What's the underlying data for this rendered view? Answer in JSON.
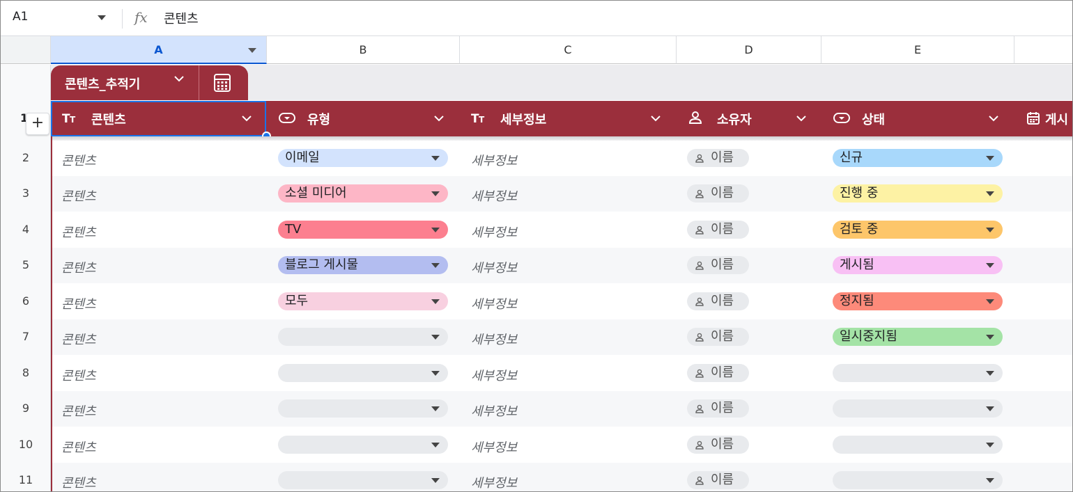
{
  "formula_bar": {
    "cell_ref": "A1",
    "fx": "fx",
    "content": "콘텐츠"
  },
  "columns": [
    "A",
    "B",
    "C",
    "D",
    "E"
  ],
  "table": {
    "name": "콘텐츠_추적기"
  },
  "headers": [
    {
      "label": "콘텐츠",
      "icon": "text-type-icon"
    },
    {
      "label": "유형",
      "icon": "dropdown-chip-icon"
    },
    {
      "label": "세부정보",
      "icon": "text-type-icon"
    },
    {
      "label": "소유자",
      "icon": "person-icon"
    },
    {
      "label": "상태",
      "icon": "dropdown-chip-icon"
    },
    {
      "label": "게시",
      "icon": "calendar-icon"
    }
  ],
  "header_row_number": "1",
  "rows": [
    {
      "num": "2",
      "content": "콘텐츠",
      "type": "이메일",
      "type_color": "#d3e3fd",
      "details": "세부정보",
      "owner": "이름",
      "status": "신규",
      "status_color": "#a8d8fb"
    },
    {
      "num": "3",
      "content": "콘텐츠",
      "type": "소셜 미디어",
      "type_color": "#fdb6c6",
      "details": "세부정보",
      "owner": "이름",
      "status": "진행 중",
      "status_color": "#fdf2a4"
    },
    {
      "num": "4",
      "content": "콘텐츠",
      "type": "TV",
      "type_color": "#fc7f8f",
      "details": "세부정보",
      "owner": "이름",
      "status": "검토 중",
      "status_color": "#fdc66a"
    },
    {
      "num": "5",
      "content": "콘텐츠",
      "type": "블로그 게시물",
      "type_color": "#b3bdf0",
      "details": "세부정보",
      "owner": "이름",
      "status": "게시됨",
      "status_color": "#f8c0f4"
    },
    {
      "num": "6",
      "content": "콘텐츠",
      "type": "모두",
      "type_color": "#f8d0e0",
      "details": "세부정보",
      "owner": "이름",
      "status": "정지됨",
      "status_color": "#fd8a7a"
    },
    {
      "num": "7",
      "content": "콘텐츠",
      "type": "",
      "type_color": "#e8eaed",
      "details": "세부정보",
      "owner": "이름",
      "status": "일시중지됨",
      "status_color": "#a4e3a6"
    },
    {
      "num": "8",
      "content": "콘텐츠",
      "type": "",
      "type_color": "#e8eaed",
      "details": "세부정보",
      "owner": "이름",
      "status": "",
      "status_color": "#e8eaed"
    },
    {
      "num": "9",
      "content": "콘텐츠",
      "type": "",
      "type_color": "#e8eaed",
      "details": "세부정보",
      "owner": "이름",
      "status": "",
      "status_color": "#e8eaed"
    },
    {
      "num": "10",
      "content": "콘텐츠",
      "type": "",
      "type_color": "#e8eaed",
      "details": "세부정보",
      "owner": "이름",
      "status": "",
      "status_color": "#e8eaed"
    },
    {
      "num": "11",
      "content": "콘텐츠",
      "type": "",
      "type_color": "#e8eaed",
      "details": "세부정보",
      "owner": "이름",
      "status": "",
      "status_color": "#e8eaed"
    }
  ]
}
